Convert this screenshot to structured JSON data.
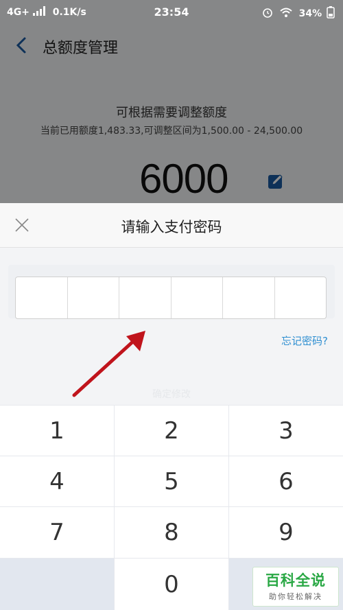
{
  "status_bar": {
    "network": "4G+",
    "speed": "0.1K/s",
    "time": "23:54",
    "battery": "34%"
  },
  "header": {
    "title": "总额度管理"
  },
  "limit": {
    "hint": "可根据需要调整额度",
    "detail": "当前已用额度1,483.33,可调整区间为1,500.00 - 24,500.00",
    "amount": "6000"
  },
  "payment_sheet": {
    "title": "请输入支付密码",
    "digits_entered": 0,
    "forgot_link": "忘记密码?",
    "ghost_button": "确定修改"
  },
  "keypad": {
    "keys": [
      "1",
      "2",
      "3",
      "4",
      "5",
      "6",
      "7",
      "8",
      "9",
      "",
      "0",
      ""
    ]
  },
  "watermark": {
    "main": "百科全说",
    "sub": "助你轻松解决"
  },
  "colors": {
    "accent": "#2f8fd1",
    "arrow": "#c0141c",
    "watermark": "#2aa845"
  }
}
